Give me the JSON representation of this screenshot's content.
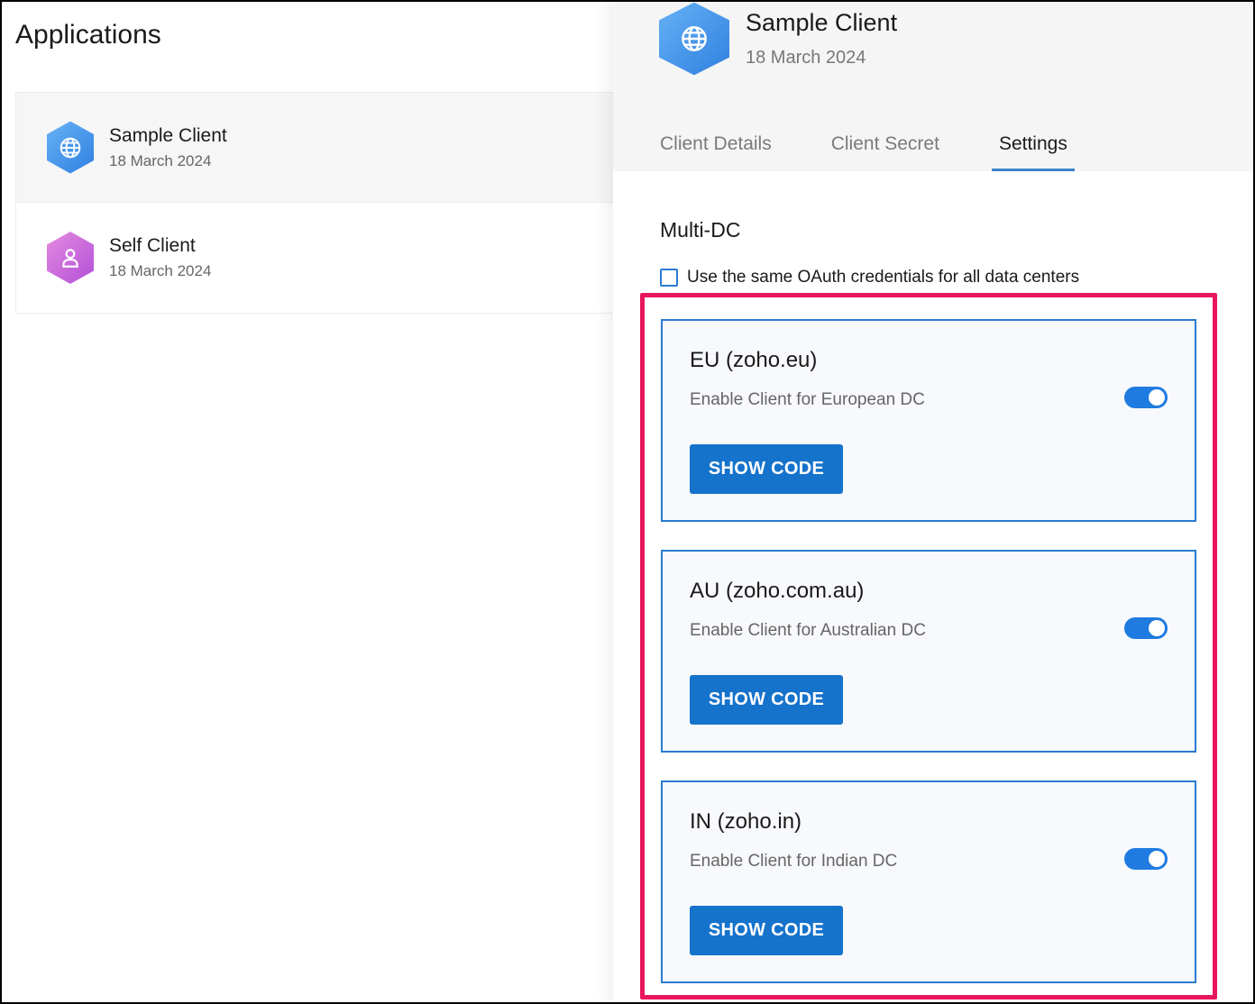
{
  "page_title": "Applications",
  "applications": [
    {
      "name": "Sample Client",
      "date": "18 March 2024",
      "icon": "globe-icon",
      "color": "#3f8ee6"
    },
    {
      "name": "Self Client",
      "date": "18 March 2024",
      "icon": "user-icon",
      "color": "#c766dd"
    }
  ],
  "detail": {
    "name": "Sample Client",
    "date": "18 March 2024",
    "icon": "globe-icon",
    "tabs": [
      {
        "label": "Client Details"
      },
      {
        "label": "Client Secret"
      },
      {
        "label": "Settings"
      }
    ],
    "active_tab": "Settings",
    "section_title": "Multi-DC",
    "checkbox_label": "Use the same OAuth credentials for all data centers",
    "data_centers": [
      {
        "title": "EU (zoho.eu)",
        "description": "Enable Client for European DC",
        "enabled": true,
        "button": "SHOW CODE"
      },
      {
        "title": "AU (zoho.com.au)",
        "description": "Enable Client for Australian DC",
        "enabled": true,
        "button": "SHOW CODE"
      },
      {
        "title": "IN (zoho.in)",
        "description": "Enable Client for Indian DC",
        "enabled": true,
        "button": "SHOW CODE"
      }
    ]
  },
  "colors": {
    "accent": "#1673cc",
    "highlight": "#e8175d",
    "toggle_on": "#1f7be0"
  }
}
